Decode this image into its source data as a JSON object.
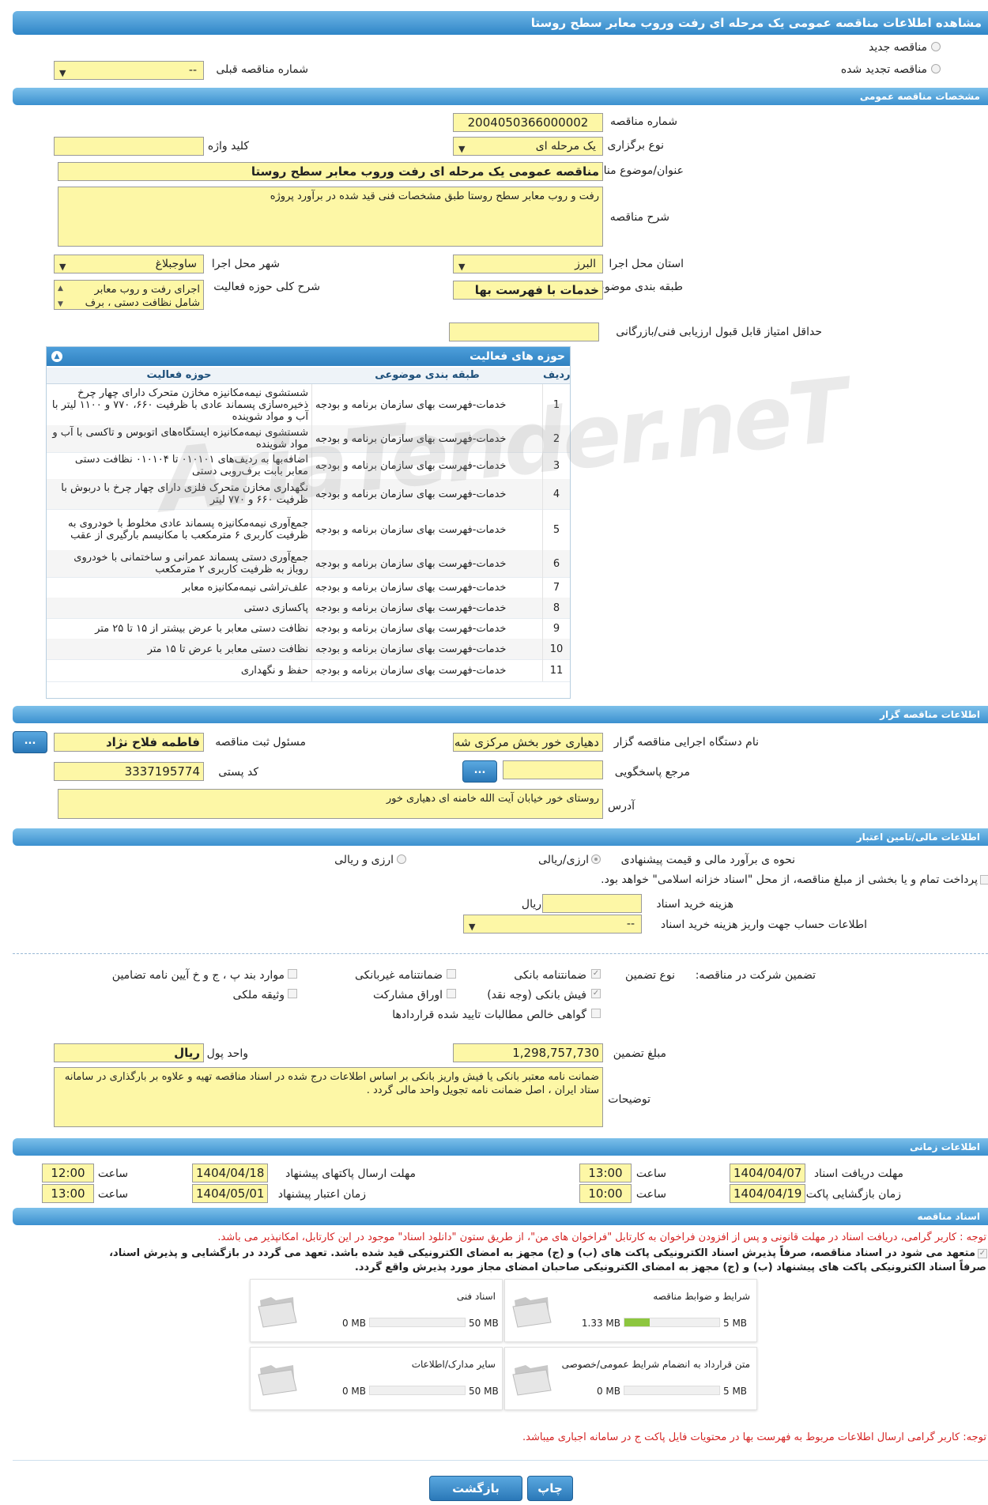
{
  "page_title": "مشاهده اطلاعات مناقصه عمومی یک مرحله ای رفت وروب معابر سطح روستا",
  "tender_type": {
    "new_label": "مناقصه جدید",
    "renewed_label": "مناقصه تجدید شده",
    "previous_number_label": "شماره مناقصه قبلی",
    "previous_number_value": "--"
  },
  "general": {
    "section_title": "مشخصات مناقصه عمومی",
    "number_label": "شماره مناقصه",
    "number_value": "2004050366000002",
    "holding_type_label": "نوع برگزاری",
    "holding_type_value": "یک مرحله ای",
    "keyword_label": "کلید واژه",
    "keyword_value": "",
    "title_label": "عنوان/موضوع مناقصه",
    "title_value": "مناقصه عمومی یک مرحله ای رفت وروب معابر سطح روستا",
    "description_label": "شرح مناقصه",
    "description_value": "رفت و روب معابر سطح روستا طبق مشخصات فنی قید شده در برآورد پروژه",
    "province_label": "استان محل اجرا",
    "province_value": "البرز",
    "city_label": "شهر محل اجرا",
    "city_value": "ساوجبلاغ",
    "category_label": "طبقه بندی موضوعی",
    "category_value": "خدمات با فهرست بها",
    "activity_desc_label": "شرح کلی حوزه فعالیت",
    "activity_desc_value": "اجرای رفت و روب  معابر شامل نظافت دستی ، برف",
    "min_score_label": "حداقل امتیاز قابل قبول ارزیابی فنی/بازرگانی",
    "min_score_value": ""
  },
  "activities": {
    "title": "حوزه های فعالیت",
    "col_row": "ردیف",
    "col_category": "طبقه بندی موضوعی",
    "col_field": "حوزه فعالیت",
    "rows": [
      {
        "n": "1",
        "cat": "خدمات-فهرست بهای سازمان برنامه و بودجه",
        "field": "شستشوی نیمه‌مکانیزه مخازن متحرک دارای چهار چرخ ذخیره‌سازی پسماند عادی با ظرفیت ۶۶۰، ۷۷۰ و ۱۱۰۰ لیتر با آب و مواد شوینده"
      },
      {
        "n": "2",
        "cat": "خدمات-فهرست بهای سازمان برنامه و بودجه",
        "field": "شستشوی نیمه‌مکانیزه ایستگاه‌های اتوبوس و تاکسی با آب و مواد شوینده"
      },
      {
        "n": "3",
        "cat": "خدمات-فهرست بهای سازمان برنامه و بودجه",
        "field": "اضافه‌بها به ردیف‌های ۰۱۰۱۰۱ تا ۰۱۰۱۰۴ نظافت دستی معابر بابت برف‌روبی دستی"
      },
      {
        "n": "4",
        "cat": "خدمات-فهرست بهای سازمان برنامه و بودجه",
        "field": "نگهداری مخازن متحرک فلزی دارای چهار چرخ با دربوش با ظرفیت ۶۶۰ و ۷۷۰ لیتر"
      },
      {
        "n": "5",
        "cat": "خدمات-فهرست بهای سازمان برنامه و بودجه",
        "field": "جمع‌آوری نیمه‌مکانیزه پسماند عادی مخلوط با خودروی به ظرفیت کاربری ۶ مترمکعب با مکانیسم بارگیری از عقب"
      },
      {
        "n": "6",
        "cat": "خدمات-فهرست بهای سازمان برنامه و بودجه",
        "field": "جمع‌آوری دستی پسماند عمرانی و ساختمانی با خودروی روباز به ظرفیت کاربری ۲ مترمکعب"
      },
      {
        "n": "7",
        "cat": "خدمات-فهرست بهای سازمان برنامه و بودجه",
        "field": "علف‌تراشی نیمه‌مکانیزه معابر"
      },
      {
        "n": "8",
        "cat": "خدمات-فهرست بهای سازمان برنامه و بودجه",
        "field": "پاکسازی دستی"
      },
      {
        "n": "9",
        "cat": "خدمات-فهرست بهای سازمان برنامه و بودجه",
        "field": "نظافت دستی معابر با عرض بیشتر از ۱۵ تا ۲۵ متر"
      },
      {
        "n": "10",
        "cat": "خدمات-فهرست بهای سازمان برنامه و بودجه",
        "field": "نظافت دستی معابر با عرض تا ۱۵ متر"
      },
      {
        "n": "11",
        "cat": "خدمات-فهرست بهای سازمان برنامه و بودجه",
        "field": "حفظ و نگهداری"
      }
    ]
  },
  "organizer": {
    "section_title": "اطلاعات مناقصه گزار",
    "device_label": "نام دستگاه اجرایی مناقصه گزار",
    "device_value": "دهیاری خور بخش مرکزی شه",
    "registrar_label": "مسئول ثبت مناقصه",
    "registrar_value": "فاطمه فلاح نژاد",
    "reference_label": "مرجع پاسخگویی",
    "reference_value": "",
    "postal_label": "کد پستی",
    "postal_value": "3337195774",
    "address_label": "آدرس",
    "address_value": "روستای خور خیابان آیت الله خامنه ای دهیاری خور",
    "more_label": "..."
  },
  "financial": {
    "section_title": "اطلاعات مالی/تامین اعتبار",
    "estimate_label": "نحوه ی برآورد مالی و قیمت پیشنهادی",
    "rial_label": "ارزی/ریالی",
    "currency_rial_label": "ارزی و ریالی",
    "treasury_text": "پرداخت تمام و یا بخشی از مبلغ مناقصه، از محل \"اسناد خزانه اسلامی\" خواهد بود.",
    "doc_cost_label": "هزینه خرید اسناد",
    "doc_cost_value": "",
    "doc_cost_unit": "ریال",
    "account_label": "اطلاعات حساب جهت واریز هزینه خرید اسناد",
    "account_value": "--"
  },
  "guarantee": {
    "participation_label": "تضمین شرکت در مناقصه:",
    "type_label": "نوع تضمین",
    "bank_guarantee": "ضمانتنامه بانکی",
    "nonbank_guarantee": "ضمانتنامه غیربانکی",
    "items_label": "موارد بند پ ، ج و خ آیین نامه تضامین",
    "bank_receipt": "فیش بانکی (وجه نقد)",
    "bonds": "اوراق مشارکت",
    "property": "وثیقه ملکی",
    "claims": "گواهی خالص مطالبات تایید شده قراردادها",
    "amount_label": "مبلغ تضمین",
    "amount_value": "1,298,757,730",
    "unit_label": "واحد پول",
    "unit_value": "ریال",
    "notes_label": "توضیحات",
    "notes_value": "ضمانت نامه معتبر بانکی یا فیش واریز بانکی بر اساس اطلاعات درج شده در اسناد مناقصه تهیه و علاوه بر بارگذاری در سامانه ستاد ایران  ،  اصل ضمانت نامه تجویل واحد مالی گردد ."
  },
  "timing": {
    "section_title": "اطلاعات زمانی",
    "doc_receive_label": "مهلت دریافت اسناد",
    "doc_receive_date": "1404/04/07",
    "doc_receive_time": "13:00",
    "submit_label": "مهلت ارسال پاکتهای پیشنهاد",
    "submit_date": "1404/04/18",
    "submit_time": "12:00",
    "open_label": "زمان بازگشایی پاکت ها",
    "open_date": "1404/04/19",
    "open_time": "10:00",
    "validity_label": "زمان اعتبار پیشنهاد",
    "validity_date": "1404/05/01",
    "validity_time": "13:00",
    "time_label": "ساعت"
  },
  "documents": {
    "section_title": "اسناد مناقصه",
    "notice1": "توجه : کاربر گرامی، دریافت اسناد در مهلت قانونی و پس از افزودن فراخوان به کارتابل \"فراخوان های من\"، از طریق ستون \"دانلود اسناد\" موجود در این کارتابل، امکانپذیر می باشد.",
    "commit_line1": "متعهد می شود در اسناد مناقصه، صرفاً پذیرش اسناد الکترونیکی پاکت های (ب) و (ج) مجهز به امضای الکترونیکی قید شده باشد. تعهد می گردد در بازگشایی و پذیرش اسناد،",
    "commit_line2": "صرفاً اسناد الکترونیکی پاکت های پیشنهاد (ب) و (ج) مجهز به امضای الکترونیکی صاحبان امضای مجاز مورد پذیرش واقع گردد.",
    "files": [
      {
        "name": "شرایط و ضوابط مناقصه",
        "current": "1.33 MB",
        "max": "5 MB",
        "fill": 0.266
      },
      {
        "name": "اسناد فنی",
        "current": "0 MB",
        "max": "50 MB",
        "fill": 0
      },
      {
        "name": "متن قرارداد به انضمام شرایط عمومی/خصوصی",
        "current": "0 MB",
        "max": "5 MB",
        "fill": 0
      },
      {
        "name": "سایر مدارک/اطلاعات",
        "current": "0 MB",
        "max": "50 MB",
        "fill": 0
      }
    ],
    "notice2": "توجه: کاربر گرامی ارسال اطلاعات مربوط به فهرست بها در محتویات فایل پاکت ج در سامانه اجباری میباشد."
  },
  "buttons": {
    "print": "چاپ",
    "back": "بازگشت"
  },
  "watermark": "AriaTender.neT"
}
